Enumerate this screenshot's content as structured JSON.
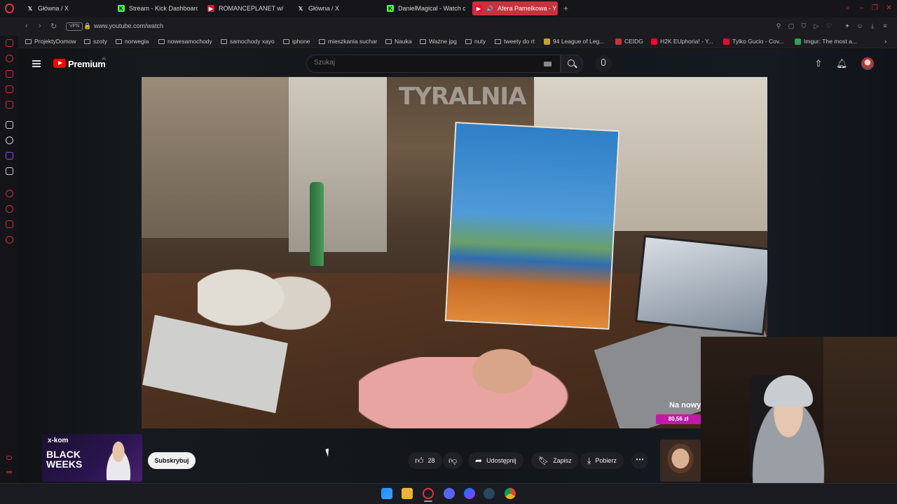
{
  "browser": {
    "tabs": [
      {
        "title": "Główna / X",
        "icon": "x-icon",
        "color": "#d6d6d6"
      },
      {
        "title": "Stream - Kick Dashboard",
        "icon": "kick-icon",
        "color": "#53fc18"
      },
      {
        "title": "ROMANCEPLANET w/ ST",
        "icon": "youtube-icon",
        "color": "#ff0033"
      },
      {
        "title": "Główna / X",
        "icon": "x-icon",
        "color": "#d6d6d6"
      },
      {
        "title": "DanielMagical - Watch c",
        "icon": "kick-icon",
        "color": "#53fc18"
      },
      {
        "title": "Afera Pamelkowa - Y",
        "icon": "youtube-icon",
        "color": "#ff0033",
        "active": true
      }
    ],
    "new_tab_label": "+",
    "vpn_label": "VPN",
    "url": "www.youtube.com/watch",
    "bookmarks": [
      {
        "label": "ProjektyDomow",
        "type": "folder"
      },
      {
        "label": "szoty",
        "type": "folder"
      },
      {
        "label": "norwegia",
        "type": "folder"
      },
      {
        "label": "nowesamochody",
        "type": "folder"
      },
      {
        "label": "samochody xayo",
        "type": "folder"
      },
      {
        "label": "iphone",
        "type": "folder"
      },
      {
        "label": "mieszkania suchar",
        "type": "folder"
      },
      {
        "label": "Nauka",
        "type": "folder"
      },
      {
        "label": "Ważne jpg",
        "type": "folder"
      },
      {
        "label": "nuty",
        "type": "folder"
      },
      {
        "label": "tweety do rt",
        "type": "folder"
      },
      {
        "label": "94 League of Leg...",
        "type": "site"
      },
      {
        "label": "CEIDG",
        "type": "site"
      },
      {
        "label": "H2K EUphoria! - Y...",
        "type": "site"
      },
      {
        "label": "Tylko Gucio - Cov...",
        "type": "site"
      },
      {
        "label": "Imgur: The most a...",
        "type": "site"
      }
    ]
  },
  "youtube": {
    "logo_text": "Premium",
    "region": "PL",
    "search_placeholder": "Szukaj",
    "video": {
      "title_overlay": "TYRALNIA",
      "promo_title": "Na nowy",
      "promo_price": "80,56 zł"
    },
    "ad": {
      "brand": "x-kom",
      "headline": "BLACK WEEKS"
    },
    "actions": {
      "subscribe": "Subskrybuj",
      "likes": "28",
      "share": "Udostępnij",
      "save": "Zapisz",
      "download": "Pobierz",
      "more": "⋯"
    }
  },
  "colors": {
    "accent_red": "#c8323c",
    "yt_red": "#ff0000",
    "promo_magenta": "#c21aa8"
  }
}
